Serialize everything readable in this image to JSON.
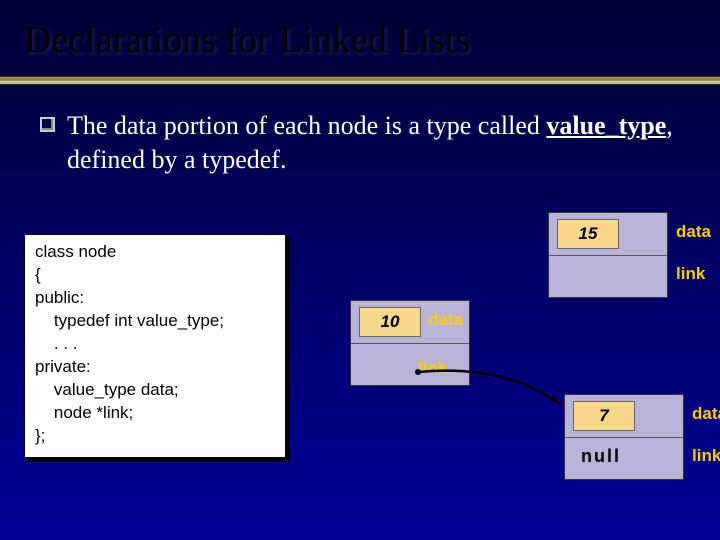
{
  "title": "Declarations for Linked Lists",
  "bullet": {
    "pre": "The data portion of each node is a type called ",
    "vt": "value_type",
    "post": ", defined by a typedef."
  },
  "code": {
    "l1": "class node",
    "l2": "{",
    "l3": "public:",
    "l4": "    typedef int value_type;",
    "l5": "    . . .",
    "l6": "private:",
    "l7": "    value_type data;",
    "l8": "    node *link;",
    "l9": "};"
  },
  "labels": {
    "data": "data",
    "link": "link"
  },
  "nodes": {
    "n15": {
      "value": "15"
    },
    "n10": {
      "value": "10"
    },
    "n7": {
      "value": "7",
      "link_text": "null"
    }
  }
}
